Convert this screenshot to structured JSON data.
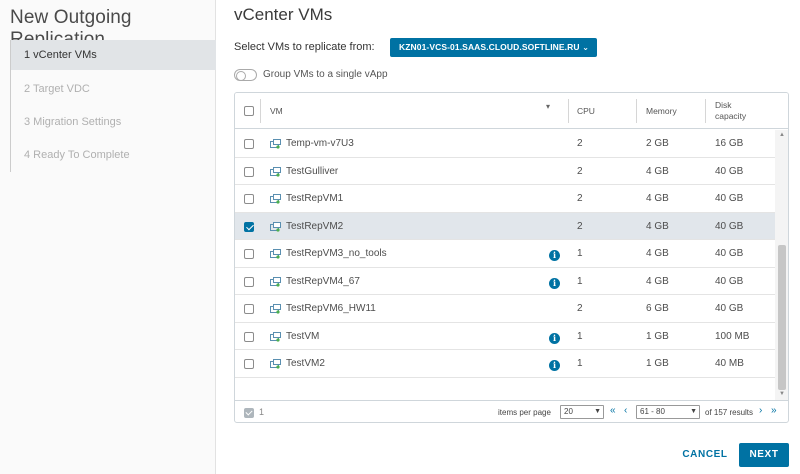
{
  "wizard": {
    "title": "New Outgoing Replication",
    "steps": [
      {
        "label": "1 vCenter VMs",
        "active": true
      },
      {
        "label": "2 Target VDC",
        "active": false
      },
      {
        "label": "3 Migration Settings",
        "active": false
      },
      {
        "label": "4 Ready To Complete",
        "active": false
      }
    ]
  },
  "page": {
    "title": "vCenter VMs",
    "source_label": "Select VMs to replicate from:",
    "source_value": "KZN01-VCS-01.SAAS.CLOUD.SOFTLINE.RU",
    "group_toggle_label": "Group VMs to a single vApp",
    "group_toggle_on": false
  },
  "grid": {
    "columns": {
      "vm": "VM",
      "cpu": "CPU",
      "memory": "Memory",
      "disk": "Disk capacity"
    },
    "rows": [
      {
        "name": "Temp-vm-v7U3",
        "cpu": "2",
        "memory": "2 GB",
        "disk": "16 GB",
        "info": false,
        "checked": false
      },
      {
        "name": "TestGulliver",
        "cpu": "2",
        "memory": "4 GB",
        "disk": "40 GB",
        "info": false,
        "checked": false
      },
      {
        "name": "TestRepVM1",
        "cpu": "2",
        "memory": "4 GB",
        "disk": "40 GB",
        "info": false,
        "checked": false
      },
      {
        "name": "TestRepVM2",
        "cpu": "2",
        "memory": "4 GB",
        "disk": "40 GB",
        "info": false,
        "checked": true
      },
      {
        "name": "TestRepVM3_no_tools",
        "cpu": "1",
        "memory": "4 GB",
        "disk": "40 GB",
        "info": true,
        "checked": false
      },
      {
        "name": "TestRepVM4_67",
        "cpu": "1",
        "memory": "4 GB",
        "disk": "40 GB",
        "info": true,
        "checked": false
      },
      {
        "name": "TestRepVM6_HW11",
        "cpu": "2",
        "memory": "6 GB",
        "disk": "40 GB",
        "info": false,
        "checked": false
      },
      {
        "name": "TestVM",
        "cpu": "1",
        "memory": "1 GB",
        "disk": "100 MB",
        "info": true,
        "checked": false
      },
      {
        "name": "TestVM2",
        "cpu": "1",
        "memory": "1 GB",
        "disk": "40 MB",
        "info": true,
        "checked": false
      }
    ],
    "footer": {
      "selected_count": "1",
      "items_per_page_label": "items per page",
      "items_per_page_value": "20",
      "range_value": "61 - 80",
      "of_label": "of 157 results"
    }
  },
  "actions": {
    "cancel": "CANCEL",
    "next": "NEXT"
  },
  "colors": {
    "accent": "#0072a3",
    "selected_row": "#e1e6eb"
  }
}
